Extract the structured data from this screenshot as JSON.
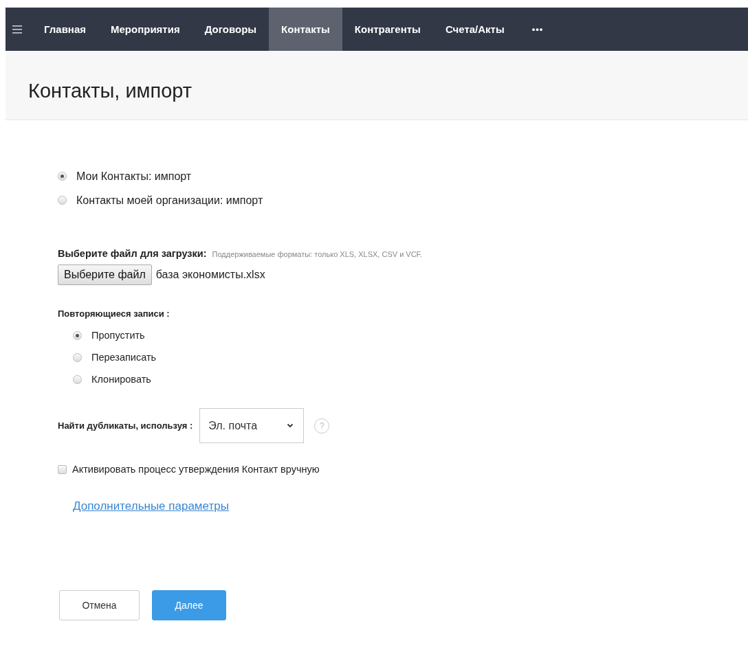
{
  "nav": {
    "items": [
      {
        "label": "Главная",
        "selected": false
      },
      {
        "label": "Мероприятия",
        "selected": false
      },
      {
        "label": "Договоры",
        "selected": false
      },
      {
        "label": "Контакты",
        "selected": true
      },
      {
        "label": "Контрагенты",
        "selected": false
      },
      {
        "label": "Счета/Акты",
        "selected": false
      }
    ],
    "more": "•••"
  },
  "page_title": "Контакты, импорт",
  "import_scope": [
    {
      "label": "Мои Контакты: импорт",
      "selected": true
    },
    {
      "label": "Контакты моей организации: импорт",
      "selected": false
    }
  ],
  "file": {
    "label": "Выберите файл для загрузки:",
    "hint": "Поддерживаемые форматы: только XLS, XLSX, CSV и VCF.",
    "button": "Выберите файл",
    "filename": "база экономисты.xlsx"
  },
  "duplicates": {
    "label": "Повторяющиеся записи :",
    "options": [
      {
        "label": "Пропустить",
        "selected": true
      },
      {
        "label": "Перезаписать",
        "selected": false
      },
      {
        "label": "Клонировать",
        "selected": false
      }
    ]
  },
  "find_by": {
    "label": "Найти дубликаты, используя :",
    "value": "Эл. почта",
    "help": "?"
  },
  "manual_approval": {
    "label": "Активировать процесс утверждения Контакт вручную",
    "checked": false
  },
  "advanced_link": "Дополнительные параметры",
  "buttons": [
    {
      "label": "Отмена",
      "kind": "secondary"
    },
    {
      "label": "Далее",
      "kind": "primary"
    }
  ]
}
